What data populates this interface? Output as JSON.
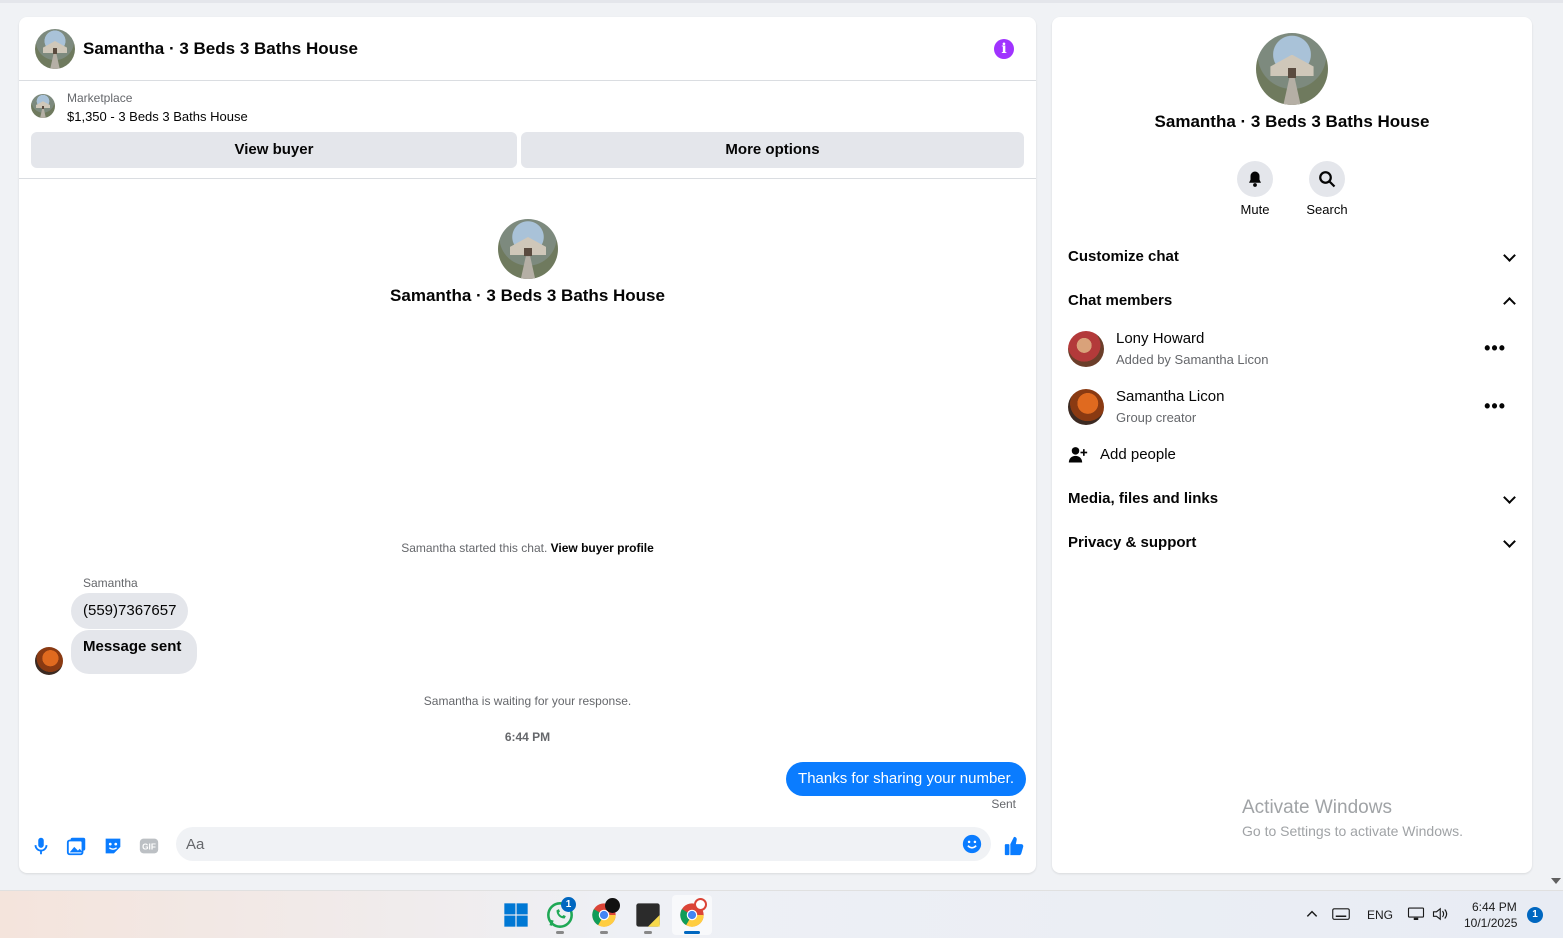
{
  "chat": {
    "title": "Samantha · 3 Beds 3 Baths House",
    "listing": {
      "label": "Marketplace",
      "price_title": "$1,350 - 3 Beds 3 Baths House"
    },
    "buttons": {
      "view_buyer": "View buyer",
      "more_options": "More options"
    },
    "intro_name": "Samantha · 3 Beds 3 Baths House",
    "started_text": "Samantha started this chat.",
    "view_buyer_profile": "View buyer profile",
    "sender_name": "Samantha",
    "messages_in": [
      "(559)7367657",
      "Message sent"
    ],
    "waiting_text": "Samantha is waiting for your response.",
    "timestamp": "6:44 PM",
    "message_out": "Thanks for sharing your number.",
    "sent_status": "Sent",
    "composer_placeholder": "Aa"
  },
  "side": {
    "name": "Samantha · 3 Beds 3 Baths House",
    "actions": {
      "mute": "Mute",
      "search": "Search"
    },
    "sections": {
      "customize": "Customize chat",
      "members": "Chat members",
      "media": "Media, files and links",
      "privacy": "Privacy & support"
    },
    "members": [
      {
        "name": "Lony Howard",
        "sub": "Added by Samantha Licon"
      },
      {
        "name": "Samantha Licon",
        "sub": "Group creator"
      }
    ],
    "add_people": "Add people",
    "watermark": {
      "line1": "Activate Windows",
      "line2": "Go to Settings to activate Windows."
    }
  },
  "taskbar": {
    "whatsapp_badge": "1",
    "lang": "ENG",
    "clock_time": "6:44 PM",
    "clock_date": "10/1/2025",
    "notif_count": "1"
  },
  "colors": {
    "accent": "#0a7cff",
    "info": "#a033ff",
    "bubble_in": "#e4e6eb"
  }
}
